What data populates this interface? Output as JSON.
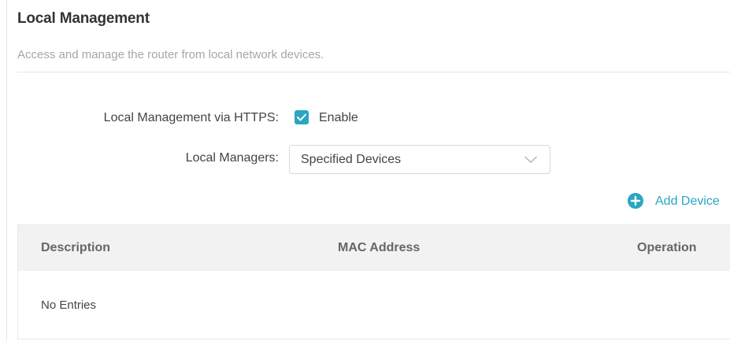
{
  "section": {
    "title": "Local Management",
    "description": "Access and manage the router from local network devices."
  },
  "https": {
    "label": "Local Management via HTTPS:",
    "checkbox_label": "Enable",
    "checked": true
  },
  "managers": {
    "label": "Local Managers:",
    "selected": "Specified Devices"
  },
  "add_device": {
    "label": "Add Device",
    "icon": "plus-circle-icon"
  },
  "table": {
    "columns": [
      "Description",
      "MAC Address",
      "Operation"
    ],
    "empty_text": "No Entries"
  },
  "colors": {
    "accent": "#2aa6c2",
    "header_bg": "#f2f2f2"
  }
}
